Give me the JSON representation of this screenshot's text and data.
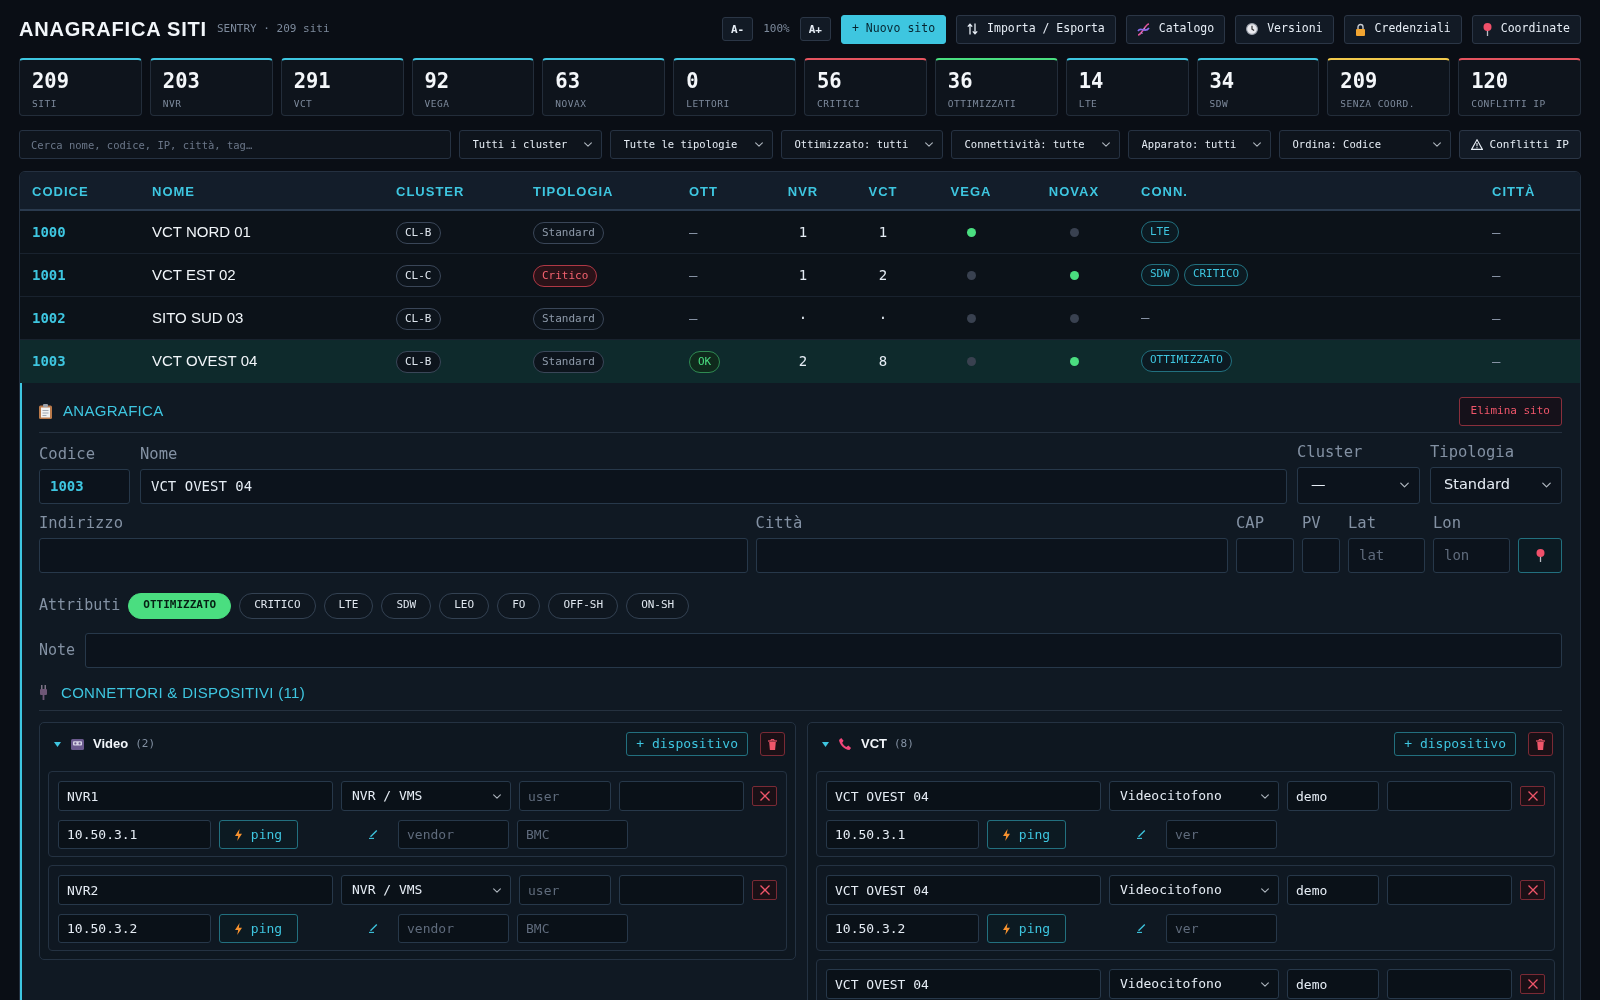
{
  "header": {
    "title": "ANAGRAFICA SITI",
    "subtitle": "SENTRY · 209 siti",
    "zoom": {
      "decrease": "A-",
      "level": "100%",
      "increase": "A+"
    },
    "actions": [
      {
        "label": "+ Nuovo sito",
        "kind": "create"
      },
      {
        "label": "Importa / Esporta",
        "kind": "transfer"
      },
      {
        "label": "Catalogo",
        "kind": "catalog"
      },
      {
        "label": "Versioni",
        "kind": "versions"
      },
      {
        "label": "Credenziali",
        "kind": "credentials"
      },
      {
        "label": "Coordinate",
        "kind": "coordinates"
      }
    ]
  },
  "stats": [
    {
      "value": "209",
      "label": "SITI",
      "color": "#3ec6e0"
    },
    {
      "value": "203",
      "label": "NVR",
      "color": "#3ec6e0"
    },
    {
      "value": "291",
      "label": "VCT",
      "color": "#3ec6e0"
    },
    {
      "value": "92",
      "label": "VEGA",
      "color": "#3ec6e0"
    },
    {
      "value": "63",
      "label": "NOVAX",
      "color": "#3ec6e0"
    },
    {
      "value": "0",
      "label": "LETTORI",
      "color": "#3ec6e0"
    },
    {
      "value": "56",
      "label": "CRITICI",
      "color": "#e5545f"
    },
    {
      "value": "36",
      "label": "OTTIMIZZATI",
      "color": "#4ade80"
    },
    {
      "value": "14",
      "label": "LTE",
      "color": "#3ec6e0"
    },
    {
      "value": "34",
      "label": "SDW",
      "color": "#3ec6e0"
    },
    {
      "value": "209",
      "label": "SENZA COORD.",
      "color": "#f2c94c"
    },
    {
      "value": "120",
      "label": "CONFLITTI IP",
      "color": "#e5545f"
    }
  ],
  "filters": {
    "search": {
      "placeholder": "Cerca nome, codice, IP, città, tag…"
    },
    "selects": [
      {
        "value": "Tutti i cluster"
      },
      {
        "value": "Tutte le tipologie"
      },
      {
        "value": "Ottimizzato: tutti"
      },
      {
        "value": "Connettività: tutte"
      },
      {
        "value": "Apparato: tutti"
      },
      {
        "value": "Ordina: Codice"
      }
    ],
    "conflicts_button": "Conflitti IP"
  },
  "table": {
    "columns": [
      {
        "label": "CODICE"
      },
      {
        "label": "NOME"
      },
      {
        "label": "CLUSTER"
      },
      {
        "label": "TIPOLOGIA"
      },
      {
        "label": "OTT"
      },
      {
        "label": "NVR"
      },
      {
        "label": "VCT"
      },
      {
        "label": "VEGA"
      },
      {
        "label": "NOVAX"
      },
      {
        "label": "CONN."
      },
      {
        "label": "CITTÀ"
      }
    ],
    "rows": [
      {
        "codice": "1000",
        "nome": "VCT NORD 01",
        "cluster": "CL-B",
        "tipologia": {
          "label": "Standard",
          "kind": "standard"
        },
        "ott": {
          "label": "—",
          "kind": "none"
        },
        "nvr": "1",
        "vct": "1",
        "vega": true,
        "novax": false,
        "conn": [
          {
            "label": "LTE",
            "kind": "tag"
          }
        ],
        "citta": "—",
        "selected": false
      },
      {
        "codice": "1001",
        "nome": "VCT EST 02",
        "cluster": "CL-C",
        "tipologia": {
          "label": "Critico",
          "kind": "critical"
        },
        "ott": {
          "label": "—",
          "kind": "none"
        },
        "nvr": "1",
        "vct": "2",
        "vega": false,
        "novax": true,
        "conn": [
          {
            "label": "SDW",
            "kind": "tag"
          },
          {
            "label": "CRITICO",
            "kind": "tag"
          }
        ],
        "citta": "—",
        "selected": false
      },
      {
        "codice": "1002",
        "nome": "SITO SUD 03",
        "cluster": "CL-B",
        "tipologia": {
          "label": "Standard",
          "kind": "standard"
        },
        "ott": {
          "label": "—",
          "kind": "none"
        },
        "nvr": "·",
        "vct": "·",
        "vega": false,
        "novax": false,
        "conn": [
          {
            "label": "—",
            "kind": "none"
          }
        ],
        "citta": "—",
        "selected": false
      },
      {
        "codice": "1003",
        "nome": "VCT OVEST 04",
        "cluster": "CL-B",
        "tipologia": {
          "label": "Standard",
          "kind": "standard"
        },
        "ott": {
          "label": "OK",
          "kind": "ok"
        },
        "nvr": "2",
        "vct": "8",
        "vega": false,
        "novax": true,
        "conn": [
          {
            "label": "OTTIMIZZATO",
            "kind": "tag"
          }
        ],
        "citta": "—",
        "selected": true
      }
    ]
  },
  "detail": {
    "title": "ANAGRAFICA",
    "delete_button": "Elimina sito",
    "codice": {
      "label": "Codice",
      "value": "1003"
    },
    "nome": {
      "label": "Nome",
      "value": "VCT OVEST 04"
    },
    "cluster": {
      "label": "Cluster",
      "value": "—"
    },
    "tipologia": {
      "label": "Tipologia",
      "value": "Standard"
    },
    "indirizzo": {
      "label": "Indirizzo"
    },
    "citta": {
      "label": "Città"
    },
    "cap": {
      "label": "CAP"
    },
    "pv": {
      "label": "PV"
    },
    "lat": {
      "label": "Lat",
      "placeholder": "lat"
    },
    "lon": {
      "label": "Lon",
      "placeholder": "lon"
    },
    "attributes": {
      "label": "Attributi",
      "items": [
        {
          "label": "OTTIMIZZATO",
          "selected": true
        },
        {
          "label": "CRITICO",
          "selected": false
        },
        {
          "label": "LTE",
          "selected": false
        },
        {
          "label": "SDW",
          "selected": false
        },
        {
          "label": "LEO",
          "selected": false
        },
        {
          "label": "FO",
          "selected": false
        },
        {
          "label": "OFF-SH",
          "selected": false
        },
        {
          "label": "ON-SH",
          "selected": false
        }
      ]
    },
    "note": {
      "label": "Note"
    }
  },
  "connectors": {
    "title": "CONNETTORI & DISPOSITIVI (11)",
    "groups": [
      {
        "name": "Video",
        "count": "(2)",
        "kind": "video",
        "expanded": true,
        "add_button": "+ dispositivo",
        "devices": [
          {
            "fields": [
              {
                "kind": "text",
                "value": "NVR1"
              },
              {
                "kind": "select",
                "value": "NVR / VMS"
              },
              {
                "kind": "text",
                "placeholder": "user"
              },
              {
                "kind": "password"
              }
            ],
            "ip": "10.50.3.1",
            "ping": "ping",
            "extras": [
              {
                "placeholder": "vendor"
              },
              {
                "placeholder": "BMC"
              }
            ]
          },
          {
            "fields": [
              {
                "kind": "text",
                "value": "NVR2"
              },
              {
                "kind": "select",
                "value": "NVR / VMS"
              },
              {
                "kind": "text",
                "placeholder": "user"
              },
              {
                "kind": "password"
              }
            ],
            "ip": "10.50.3.2",
            "ping": "ping",
            "extras": [
              {
                "placeholder": "vendor"
              },
              {
                "placeholder": "BMC"
              }
            ]
          }
        ]
      },
      {
        "name": "VCT",
        "count": "(8)",
        "kind": "intercom",
        "expanded": true,
        "add_button": "+ dispositivo",
        "devices": [
          {
            "fields": [
              {
                "kind": "text",
                "value": "VCT OVEST 04"
              },
              {
                "kind": "select",
                "value": "Videocitofono"
              },
              {
                "kind": "text",
                "value": "demo"
              },
              {
                "kind": "password"
              }
            ],
            "ip": "10.50.3.1",
            "ping": "ping",
            "extras": [
              {
                "placeholder": "ver"
              }
            ]
          },
          {
            "fields": [
              {
                "kind": "text",
                "value": "VCT OVEST 04"
              },
              {
                "kind": "select",
                "value": "Videocitofono"
              },
              {
                "kind": "text",
                "value": "demo"
              },
              {
                "kind": "password"
              }
            ],
            "ip": "10.50.3.2",
            "ping": "ping",
            "extras": [
              {
                "placeholder": "ver"
              }
            ]
          },
          {
            "fields": [
              {
                "kind": "text",
                "value": "VCT OVEST 04"
              },
              {
                "kind": "select",
                "value": "Videocitofono"
              },
              {
                "kind": "text",
                "value": "demo"
              },
              {
                "kind": "password"
              }
            ]
          }
        ]
      }
    ]
  }
}
